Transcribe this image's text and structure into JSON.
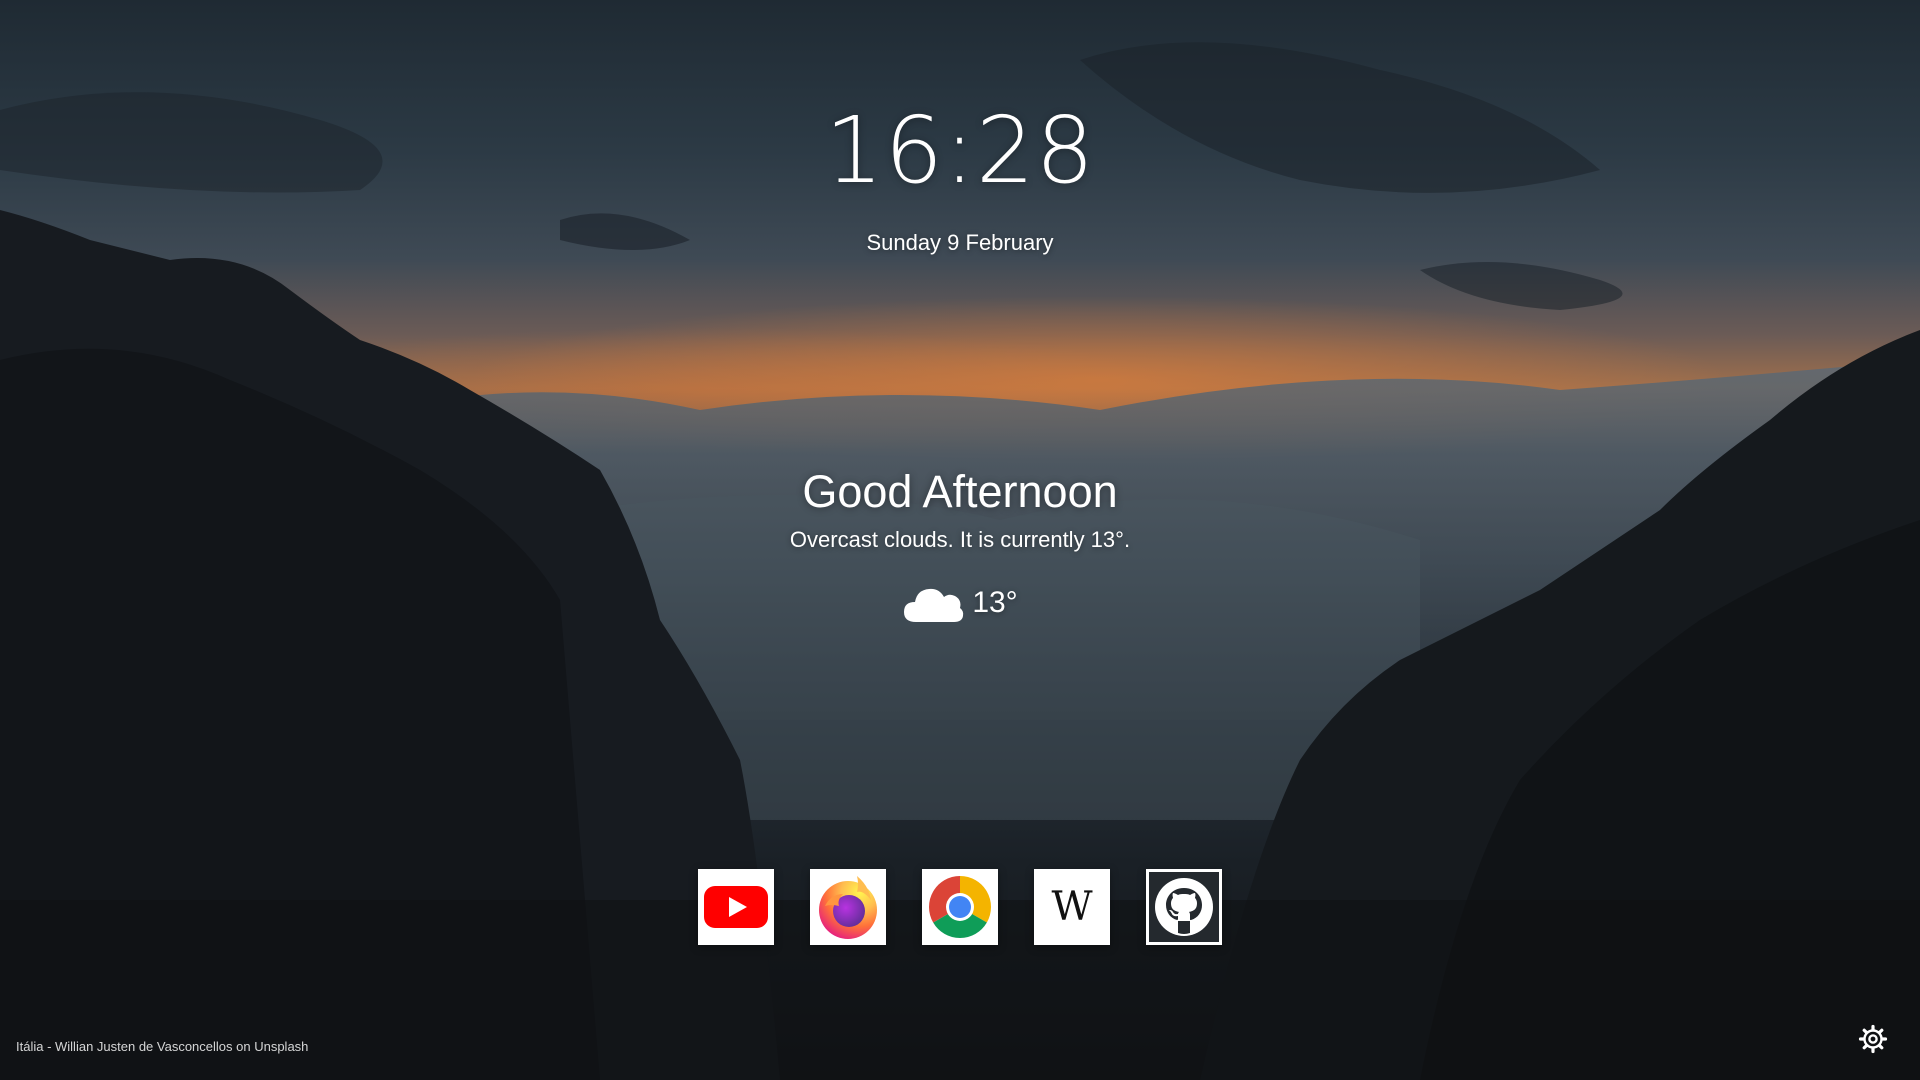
{
  "clock": {
    "time": "16:28",
    "date": "Sunday 9 February"
  },
  "greeting": {
    "text": "Good Afternoon",
    "weather_description": "Overcast clouds. It is currently 13°."
  },
  "weather": {
    "icon": "cloud-icon",
    "temperature": "13°"
  },
  "quick_links": [
    {
      "name": "YouTube",
      "icon": "youtube-icon"
    },
    {
      "name": "Firefox",
      "icon": "firefox-icon"
    },
    {
      "name": "Chrome",
      "icon": "chrome-icon"
    },
    {
      "name": "Wikipedia",
      "icon": "wikipedia-icon",
      "letter": "W"
    },
    {
      "name": "GitHub",
      "icon": "github-icon"
    }
  ],
  "footer": {
    "photo_credit": "Itália - Willian Justen de Vasconcellos on Unsplash",
    "settings_icon": "gear-icon"
  },
  "colors": {
    "youtube_red": "#ff0000",
    "chrome_red": "#db4437",
    "chrome_yellow": "#f4b400",
    "chrome_green": "#0f9d58",
    "chrome_blue": "#4285f4",
    "github_dark": "#24292e"
  }
}
